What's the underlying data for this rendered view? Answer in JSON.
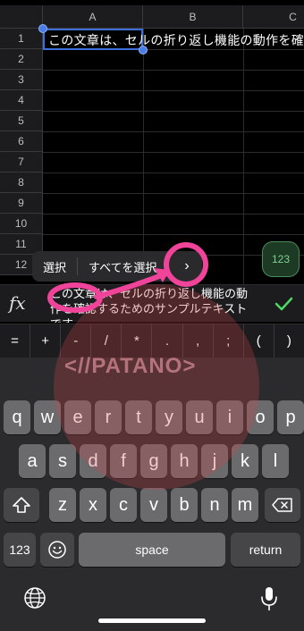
{
  "spreadsheet": {
    "columns": [
      "A",
      "B",
      "C"
    ],
    "rows": [
      "1",
      "2",
      "3",
      "4",
      "5",
      "6",
      "7",
      "8",
      "9",
      "10",
      "11",
      "12"
    ],
    "cell_a1": "この文章は、セルの折り返し機能の動作を確認"
  },
  "edit_menu": {
    "select": "選択",
    "select_all": "すべてを選択",
    "more": "›"
  },
  "mode_button": {
    "label": "123"
  },
  "formula_bar": {
    "fx": "fx",
    "text": "この文章は、セルの折り返し機能の動作を確認するためのサンプルテキストです"
  },
  "symbol_keys": [
    "=",
    "+",
    "-",
    "/",
    "*",
    ".",
    ",",
    ";",
    "(",
    ")"
  ],
  "watermark": {
    "text": "<//PATANO>"
  },
  "keyboard": {
    "row1": [
      "q",
      "w",
      "e",
      "r",
      "t",
      "y",
      "u",
      "i",
      "o",
      "p"
    ],
    "row2": [
      "a",
      "s",
      "d",
      "f",
      "g",
      "h",
      "j",
      "k",
      "l"
    ],
    "row3": [
      "z",
      "x",
      "c",
      "v",
      "b",
      "n",
      "m"
    ],
    "numbers_label": "123",
    "space_label": "space",
    "return_label": "return"
  },
  "colors": {
    "annotation": "#f0449a",
    "accent_green": "#4cd964",
    "selection_blue": "#3f6fd8"
  }
}
